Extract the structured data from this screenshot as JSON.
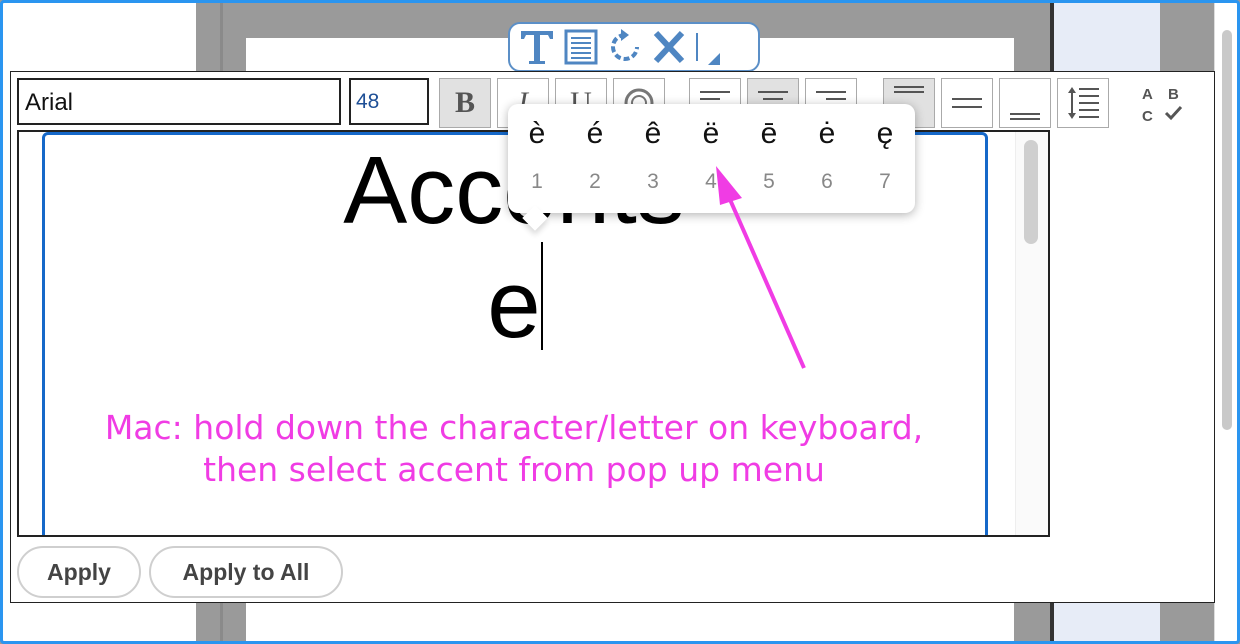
{
  "toolbar": {
    "font_name": "Arial",
    "font_size": "48",
    "bold_label": "B",
    "italic_label": "I",
    "underline_label": "U"
  },
  "content": {
    "line1": "Accents",
    "line2": "e"
  },
  "accent_popup": {
    "options": [
      {
        "char": "è",
        "num": "1"
      },
      {
        "char": "é",
        "num": "2"
      },
      {
        "char": "ê",
        "num": "3"
      },
      {
        "char": "ë",
        "num": "4"
      },
      {
        "char": "ē",
        "num": "5"
      },
      {
        "char": "ė",
        "num": "6"
      },
      {
        "char": "ę",
        "num": "7"
      }
    ]
  },
  "annotation": {
    "line1": "Mac: hold down the character/letter on keyboard,",
    "line2": "then select accent from pop up menu",
    "color": "#f03ce4"
  },
  "buttons": {
    "apply": "Apply",
    "apply_all": "Apply to All"
  },
  "spellcheck_icon": {
    "letters": [
      "A",
      "B",
      "C"
    ]
  },
  "colors": {
    "frame": "#2a95f0",
    "text_frame": "#1568c9",
    "mini_toolbar_border": "#5b8fc7"
  }
}
